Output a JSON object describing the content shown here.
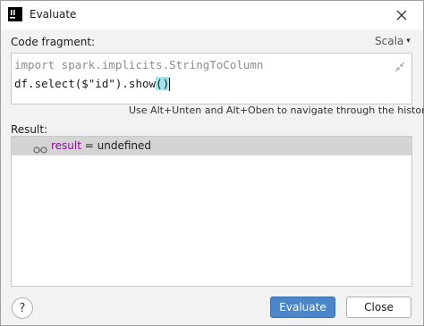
{
  "window": {
    "title": "Evaluate"
  },
  "code_section": {
    "label": "Code fragment:",
    "language": "Scala",
    "lines": [
      "import spark.implicits.StringToColumn",
      "df.select($\"id\").show",
      "()"
    ]
  },
  "history_hint": "Use Alt+Unten and Alt+Oben to navigate through the history",
  "result_section": {
    "label": "Result:",
    "row": {
      "name": "result",
      "rest": " = undefined"
    }
  },
  "buttons": {
    "help": "?",
    "evaluate": "Evaluate",
    "close": "Close"
  },
  "icons": {
    "app": "intellij-icon",
    "close": "close-icon",
    "collapse": "collapse-icon",
    "watch": "glasses-icon",
    "dropdown": "chevron-down-icon"
  },
  "colors": {
    "primary_button": "#4a86c8",
    "result_row_bg": "#d4d4d4",
    "result_name": "#871094",
    "paren_highlight": "#a4e4ea"
  }
}
